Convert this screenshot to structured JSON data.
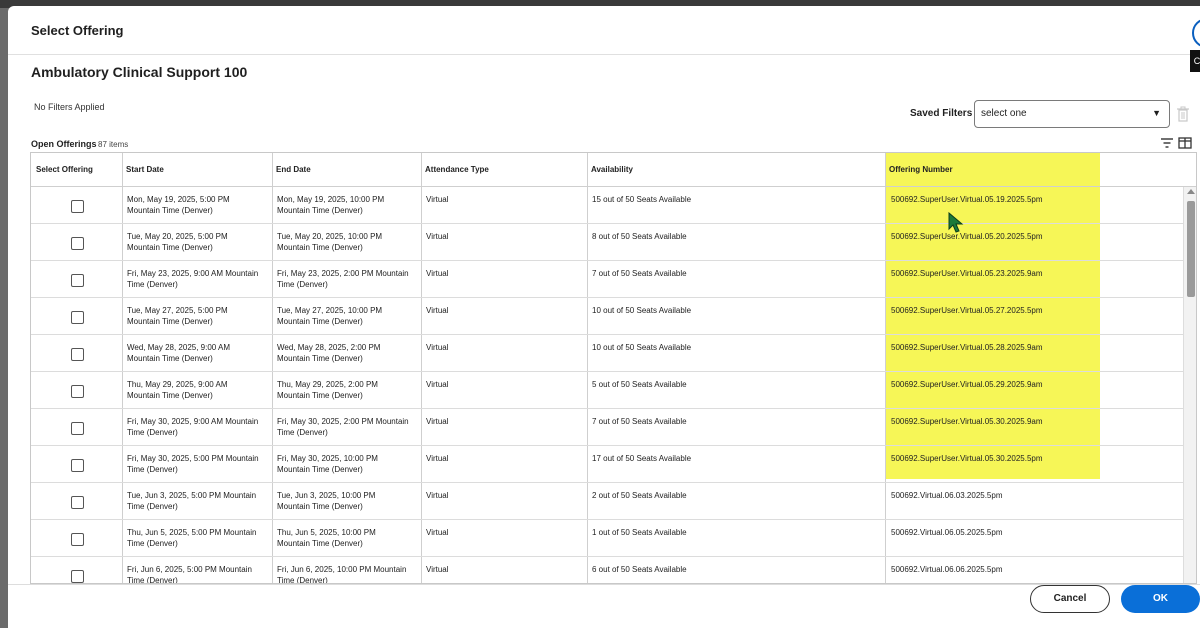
{
  "dialog": {
    "title": "Select Offering",
    "course_title": "Ambulatory Clinical Support 100",
    "close_tooltip": "C"
  },
  "filters": {
    "status": "No Filters Applied",
    "saved_label": "Saved Filters",
    "saved_value": "select one"
  },
  "offerings": {
    "label": "Open Offerings",
    "count": "87 items"
  },
  "table": {
    "headers": [
      "Select Offering",
      "Start Date",
      "End Date",
      "Attendance Type",
      "Availability",
      "Offering Number"
    ],
    "rows": [
      {
        "start1": "Mon, May 19, 2025, 5:00 PM",
        "start2": "Mountain Time (Denver)",
        "end1": "Mon, May 19, 2025, 10:00 PM",
        "end2": "Mountain Time (Denver)",
        "type": "Virtual",
        "avail": "15 out of 50 Seats Available",
        "num": "500692.SuperUser.Virtual.05.19.2025.5pm"
      },
      {
        "start1": "Tue, May 20, 2025, 5:00 PM",
        "start2": "Mountain Time (Denver)",
        "end1": "Tue, May 20, 2025, 10:00 PM",
        "end2": "Mountain Time (Denver)",
        "type": "Virtual",
        "avail": "8 out of 50 Seats Available",
        "num": "500692.SuperUser.Virtual.05.20.2025.5pm"
      },
      {
        "start1": "Fri, May 23, 2025, 9:00 AM Mountain",
        "start2": "Time (Denver)",
        "end1": "Fri, May 23, 2025, 2:00 PM Mountain",
        "end2": "Time (Denver)",
        "type": "Virtual",
        "avail": "7 out of 50 Seats Available",
        "num": "500692.SuperUser.Virtual.05.23.2025.9am"
      },
      {
        "start1": "Tue, May 27, 2025, 5:00 PM",
        "start2": "Mountain Time (Denver)",
        "end1": "Tue, May 27, 2025, 10:00 PM",
        "end2": "Mountain Time (Denver)",
        "type": "Virtual",
        "avail": "10 out of 50 Seats Available",
        "num": "500692.SuperUser.Virtual.05.27.2025.5pm"
      },
      {
        "start1": "Wed, May 28, 2025, 9:00 AM",
        "start2": "Mountain Time (Denver)",
        "end1": "Wed, May 28, 2025, 2:00 PM",
        "end2": "Mountain Time (Denver)",
        "type": "Virtual",
        "avail": "10 out of 50 Seats Available",
        "num": "500692.SuperUser.Virtual.05.28.2025.9am"
      },
      {
        "start1": "Thu, May 29, 2025, 9:00 AM",
        "start2": "Mountain Time (Denver)",
        "end1": "Thu, May 29, 2025, 2:00 PM",
        "end2": "Mountain Time (Denver)",
        "type": "Virtual",
        "avail": "5 out of 50 Seats Available",
        "num": "500692.SuperUser.Virtual.05.29.2025.9am"
      },
      {
        "start1": "Fri, May 30, 2025, 9:00 AM Mountain",
        "start2": "Time (Denver)",
        "end1": "Fri, May 30, 2025, 2:00 PM Mountain",
        "end2": "Time (Denver)",
        "type": "Virtual",
        "avail": "7 out of 50 Seats Available",
        "num": "500692.SuperUser.Virtual.05.30.2025.9am"
      },
      {
        "start1": "Fri, May 30, 2025, 5:00 PM Mountain",
        "start2": "Time (Denver)",
        "end1": "Fri, May 30, 2025, 10:00 PM",
        "end2": "Mountain Time (Denver)",
        "type": "Virtual",
        "avail": "17 out of 50 Seats Available",
        "num": "500692.SuperUser.Virtual.05.30.2025.5pm"
      },
      {
        "start1": "Tue, Jun 3, 2025, 5:00 PM Mountain",
        "start2": "Time (Denver)",
        "end1": "Tue, Jun 3, 2025, 10:00 PM",
        "end2": "Mountain Time (Denver)",
        "type": "Virtual",
        "avail": "2 out of 50 Seats Available",
        "num": "500692.Virtual.06.03.2025.5pm"
      },
      {
        "start1": "Thu, Jun 5, 2025, 5:00 PM Mountain",
        "start2": "Time (Denver)",
        "end1": "Thu, Jun 5, 2025, 10:00 PM",
        "end2": "Mountain Time (Denver)",
        "type": "Virtual",
        "avail": "1 out of 50 Seats Available",
        "num": "500692.Virtual.06.05.2025.5pm"
      },
      {
        "start1": "Fri, Jun 6, 2025, 5:00 PM Mountain",
        "start2": "Time (Denver)",
        "end1": "Fri, Jun 6, 2025, 10:00 PM Mountain",
        "end2": "Time (Denver)",
        "type": "Virtual",
        "avail": "6 out of 50 Seats Available",
        "num": "500692.Virtual.06.06.2025.5pm"
      }
    ]
  },
  "footer": {
    "cancel_label": "Cancel",
    "ok_label": "OK"
  },
  "colors": {
    "primary": "#0a6fd8",
    "highlight": "#f5f53a",
    "cursor": "#1a7a3a"
  }
}
